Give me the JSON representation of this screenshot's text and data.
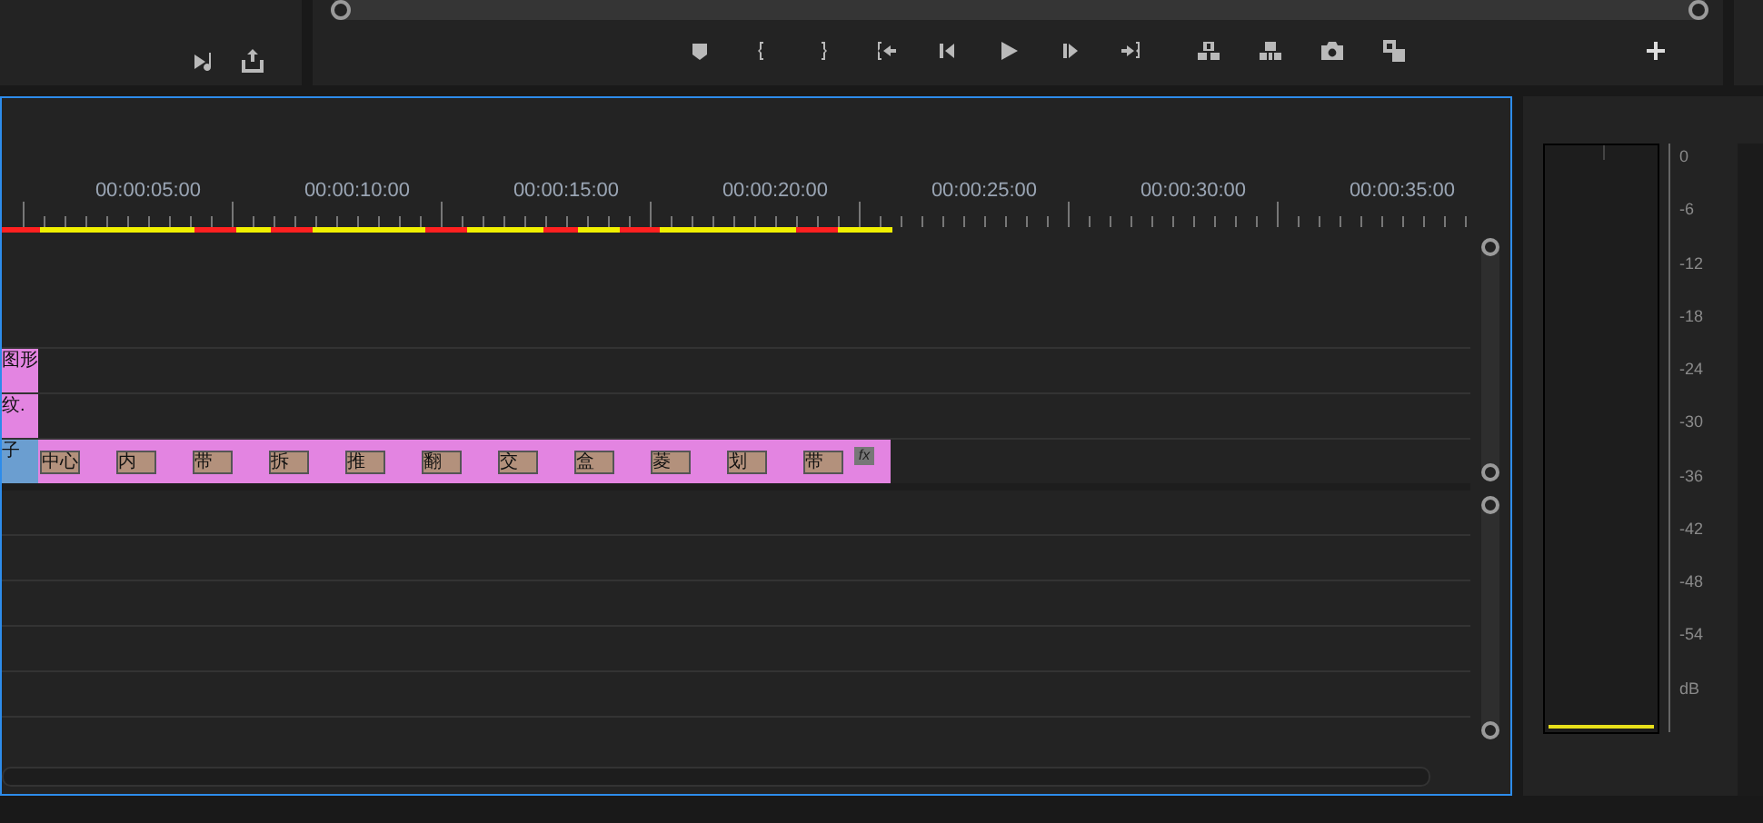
{
  "timeline": {
    "ruler_labels": [
      "00:00:05:00",
      "00:00:10:00",
      "00:00:15:00",
      "00:00:20:00",
      "00:00:25:00",
      "00:00:30:00",
      "00:00:35:00"
    ],
    "clips": [
      {
        "label": "图形"
      },
      {
        "label": "纹."
      }
    ],
    "main_track": {
      "first_clip": "子",
      "transitions": [
        "中心",
        "内",
        "带",
        "拆",
        "推",
        "翻",
        "交",
        "盒",
        "菱",
        "划",
        "带"
      ],
      "effect_badge": "fx"
    }
  },
  "audio_meter": {
    "scale": [
      "0",
      "-6",
      "-12",
      "-18",
      "-24",
      "-30",
      "-36",
      "-42",
      "-48",
      "-54"
    ],
    "unit": "dB"
  }
}
